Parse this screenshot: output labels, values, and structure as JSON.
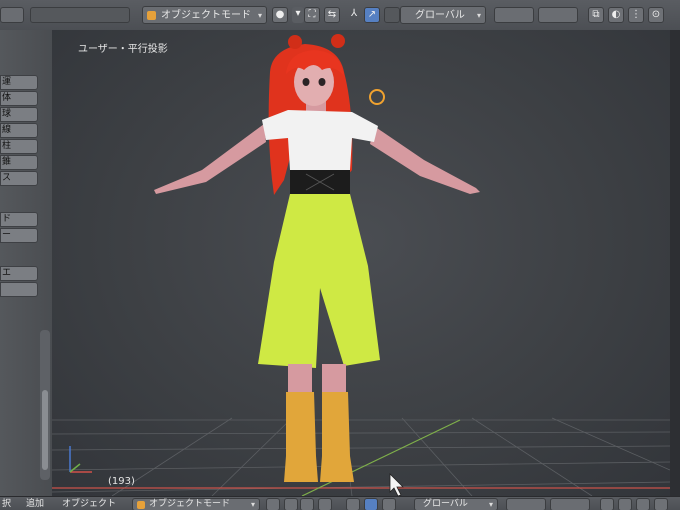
{
  "header": {
    "mode_label": "オブジェクトモード",
    "orientation_label": "グローバル"
  },
  "viewport": {
    "view_label": "ユーザー・平行投影",
    "frame_label": "(193)"
  },
  "bottom_menu": {
    "select": "択",
    "add": "追加",
    "object": "オブジェクト",
    "mode_label": "オブジェクトモード",
    "orientation_label": "グローバル"
  },
  "tool_shelf": {
    "tabs": [
      "運",
      "体",
      "球",
      "線",
      "柱",
      "錐",
      "ス",
      "ド",
      "ー",
      "エ"
    ]
  },
  "colors": {
    "hair": "#e0331d",
    "skin": "#d69aa0",
    "top": "#f2f2f2",
    "pants": "#cfe944",
    "boots": "#e1a63a",
    "belt": "#1c1c1c",
    "accent": "#5680c2"
  }
}
